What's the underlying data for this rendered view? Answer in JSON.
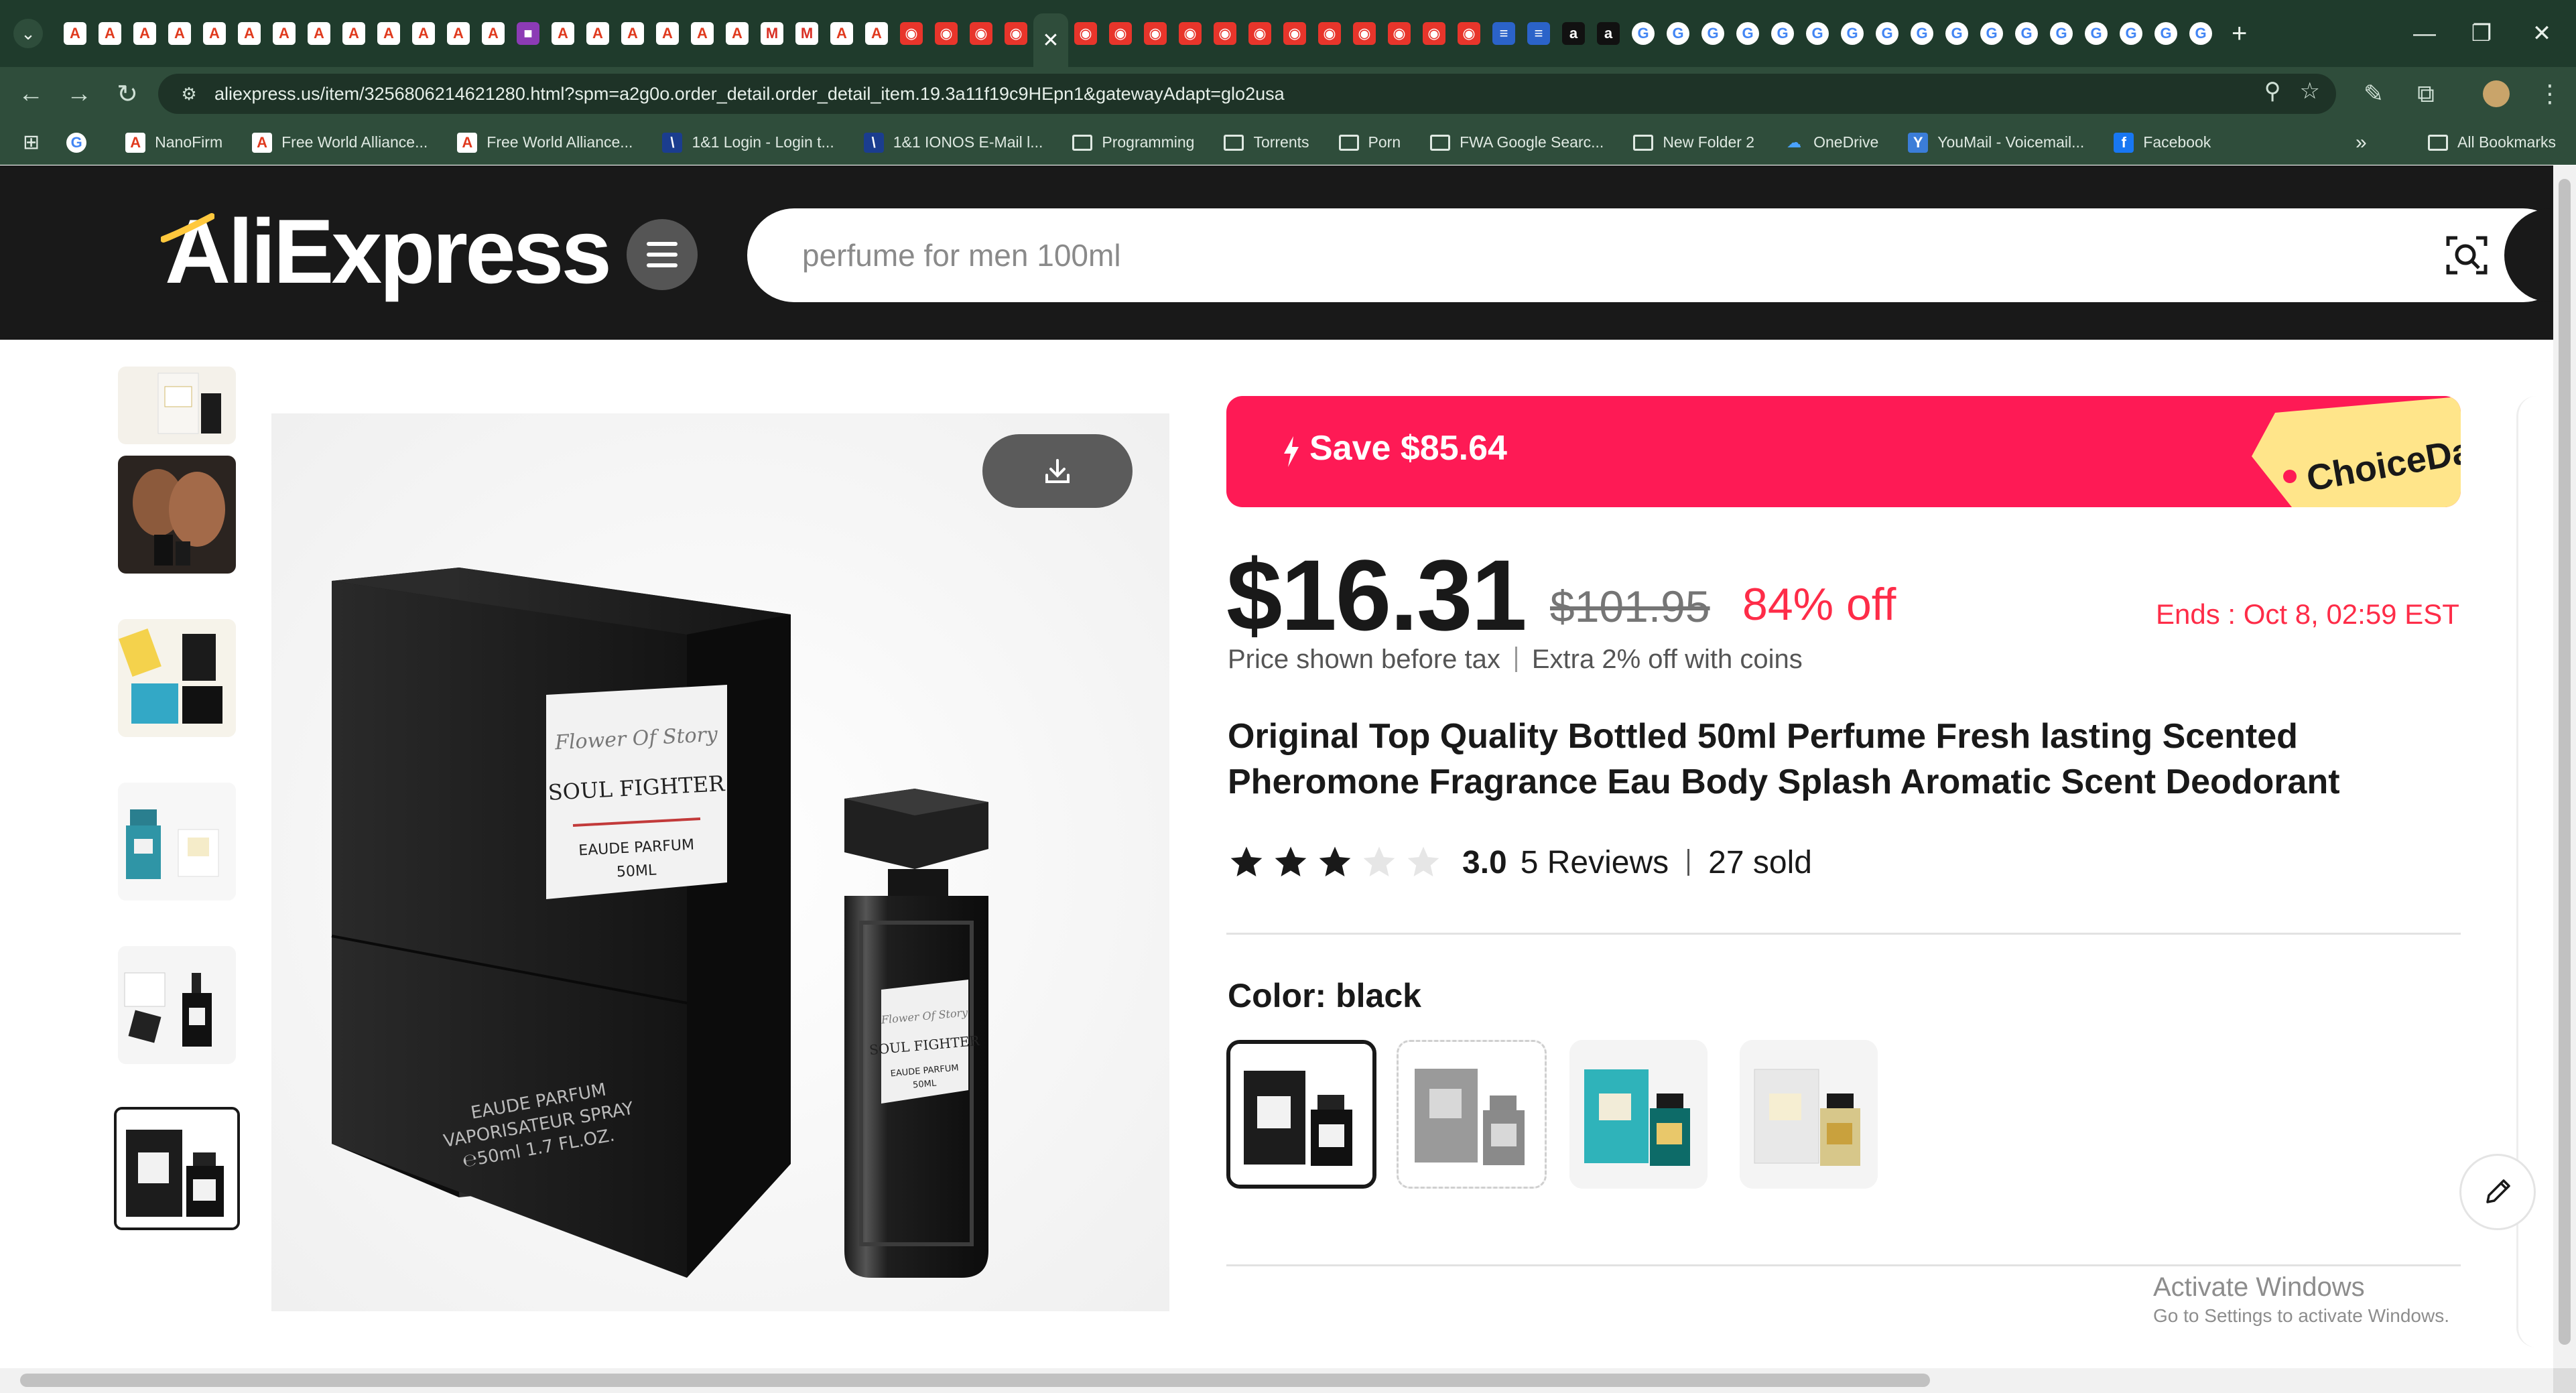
{
  "browser": {
    "tab_favicons": [
      "ae",
      "ae",
      "ae",
      "ae",
      "ae",
      "ae",
      "ae",
      "ae",
      "ae",
      "ae",
      "ae",
      "ae",
      "ae",
      "pur",
      "ae",
      "ae",
      "ae",
      "ae",
      "ae",
      "ae",
      "gm",
      "gm",
      "ae",
      "ae",
      "red",
      "red",
      "red",
      "red",
      "active",
      "red",
      "red",
      "red",
      "red",
      "red",
      "red",
      "red",
      "red",
      "red",
      "red",
      "red",
      "red",
      "blue",
      "blue",
      "dark",
      "dark",
      "g",
      "g",
      "g",
      "g",
      "g",
      "g",
      "g",
      "g",
      "g",
      "g",
      "g",
      "g",
      "g",
      "g",
      "g",
      "g",
      "g"
    ],
    "url": "aliexpress.us/item/3256806214621280.html?spm=a2g0o.order_detail.order_detail_item.19.3a11f19c9HEpn1&gatewayAdapt=glo2usa",
    "bookmarks": [
      {
        "label": "",
        "icon": "google-icon"
      },
      {
        "label": "NanoFirm",
        "icon": "ae-icon"
      },
      {
        "label": "Free World Alliance...",
        "icon": "ae-icon"
      },
      {
        "label": "Free World Alliance...",
        "icon": "ae-icon"
      },
      {
        "label": "1&1 Login - Login t...",
        "icon": "ionos-icon"
      },
      {
        "label": "1&1 IONOS E-Mail l...",
        "icon": "ionos-icon"
      },
      {
        "label": "Programming",
        "icon": "folder-icon"
      },
      {
        "label": "Torrents",
        "icon": "folder-icon"
      },
      {
        "label": "Porn",
        "icon": "folder-icon"
      },
      {
        "label": "FWA Google Searc...",
        "icon": "folder-icon"
      },
      {
        "label": "New Folder 2",
        "icon": "folder-icon"
      },
      {
        "label": "OneDrive",
        "icon": "onedrive-icon"
      },
      {
        "label": "YouMail - Voicemail...",
        "icon": "youmail-icon"
      },
      {
        "label": "Facebook",
        "icon": "facebook-icon"
      }
    ],
    "bookmarks_more": "»",
    "all_bookmarks": "All Bookmarks"
  },
  "site": {
    "logo": "AliExpress",
    "search_placeholder": "perfume for men 100ml"
  },
  "product": {
    "save_banner": "Save $85.64",
    "choice_tag": "ChoiceDay",
    "price": "$16.31",
    "original_price": "$101.95",
    "discount": "84% off",
    "ends": "Ends :  Oct 8, 02:59 EST",
    "tax_note": "Price shown before tax",
    "coins_note": "Extra 2% off with coins",
    "title": "Original Top Quality Bottled 50ml Perfume Fresh lasting Scented Pheromone Fragrance Eau Body Splash Aromatic Scent Deodorant",
    "rating": 3,
    "rating_text": "3.0",
    "reviews": "5 Reviews",
    "sold": "27 sold",
    "color_label": "Color: black",
    "label_brand": "Flower Of Story",
    "label_name": "SOUL FIGHTER",
    "label_type": "EAUDE PARFUM",
    "label_size": "50ML",
    "box_text_1": "EAUDE PARFUM",
    "box_text_2": "VAPORISATEUR SPRAY",
    "box_text_3": "℮50ml  1.7 FL.OZ."
  },
  "os": {
    "activate_title": "Activate Windows",
    "activate_sub": "Go to Settings to activate Windows."
  },
  "colors": {
    "tab_bg": "#1f3b2c",
    "toolbar_bg": "#2f4d3b",
    "header_bg": "#191919",
    "accent_red": "#fe2c48",
    "banner_pink": "#fe1a55",
    "choice_yellow": "#ffe58a"
  }
}
